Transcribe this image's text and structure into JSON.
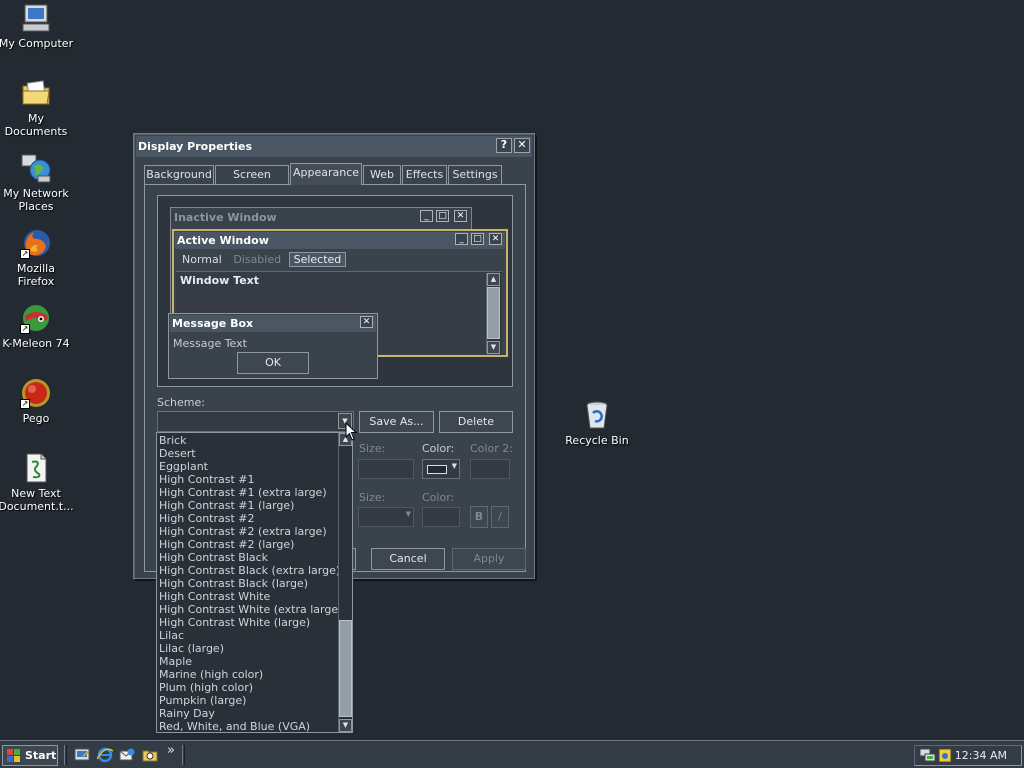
{
  "desktop": {
    "icons": [
      {
        "label": "My Computer"
      },
      {
        "label": "My Documents"
      },
      {
        "label": "My Network Places"
      },
      {
        "label": "Mozilla Firefox"
      },
      {
        "label": "K-Meleon 74"
      },
      {
        "label": "Pego"
      },
      {
        "label": "New Text Document.t..."
      },
      {
        "label": "Recycle Bin"
      }
    ]
  },
  "window": {
    "title": "Display Properties",
    "help_glyph": "?",
    "close_glyph": "✕",
    "tabs": [
      {
        "label": "Background"
      },
      {
        "label": "Screen Saver"
      },
      {
        "label": "Appearance"
      },
      {
        "label": "Web"
      },
      {
        "label": "Effects"
      },
      {
        "label": "Settings"
      }
    ],
    "active_tab": "Appearance",
    "preview": {
      "inactive_title": "Inactive Window",
      "active_title": "Active Window",
      "menu_normal": "Normal",
      "menu_disabled": "Disabled",
      "menu_selected": "Selected",
      "window_text": "Window Text",
      "message_box_title": "Message Box",
      "message_text": "Message Text",
      "ok_label": "OK"
    },
    "scheme_label": "Scheme:",
    "scheme_value": "",
    "save_as_label": "Save As...",
    "delete_label": "Delete",
    "size_label": "Size:",
    "color_label": "Color:",
    "color2_label": "Color 2:",
    "bold_label": "B",
    "italic_label": "/",
    "cancel_label": "Cancel",
    "apply_label": "Apply"
  },
  "scheme_options": [
    "Brick",
    "Desert",
    "Eggplant",
    "High Contrast #1",
    "High Contrast #1 (extra large)",
    "High Contrast #1 (large)",
    "High Contrast #2",
    "High Contrast #2 (extra large)",
    "High Contrast #2 (large)",
    "High Contrast Black",
    "High Contrast Black (extra large)",
    "High Contrast Black (large)",
    "High Contrast White",
    "High Contrast White (extra large)",
    "High Contrast White (large)",
    "Lilac",
    "Lilac (large)",
    "Maple",
    "Marine (high color)",
    "Plum (high color)",
    "Pumpkin (large)",
    "Rainy Day",
    "Red, White, and Blue (VGA)"
  ],
  "taskbar": {
    "start_label": "Start",
    "chevron": "»",
    "clock": "12:34 AM"
  },
  "colors": {
    "desktop": "#232a32",
    "window_face": "#3a424b",
    "active_title": "#4a5664",
    "preview_border_accent": "#c8b46a"
  }
}
